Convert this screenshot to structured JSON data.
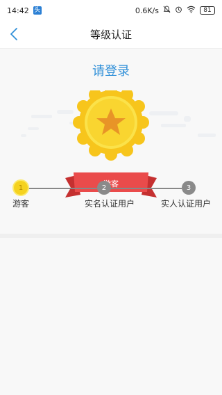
{
  "status_bar": {
    "time": "14:42",
    "app_badge": "头",
    "net_speed": "0.6K/s",
    "battery": "81"
  },
  "header": {
    "title": "等级认证",
    "back_icon": "chevron-left-icon"
  },
  "main": {
    "login_prompt": "请登录",
    "badge": {
      "caption": "游客",
      "icon": "star-medal-icon"
    },
    "steps": [
      {
        "number": "1",
        "label": "游客",
        "active": true
      },
      {
        "number": "2",
        "label": "实名认证用户",
        "active": false
      },
      {
        "number": "3",
        "label": "实人认证用户",
        "active": false
      }
    ]
  },
  "colors": {
    "accent": "#2f8fd8",
    "active_step": "#f5d21f",
    "inactive_step": "#8a8a8a",
    "ribbon": "#ea4b4b",
    "gold": "#f5c21a"
  }
}
